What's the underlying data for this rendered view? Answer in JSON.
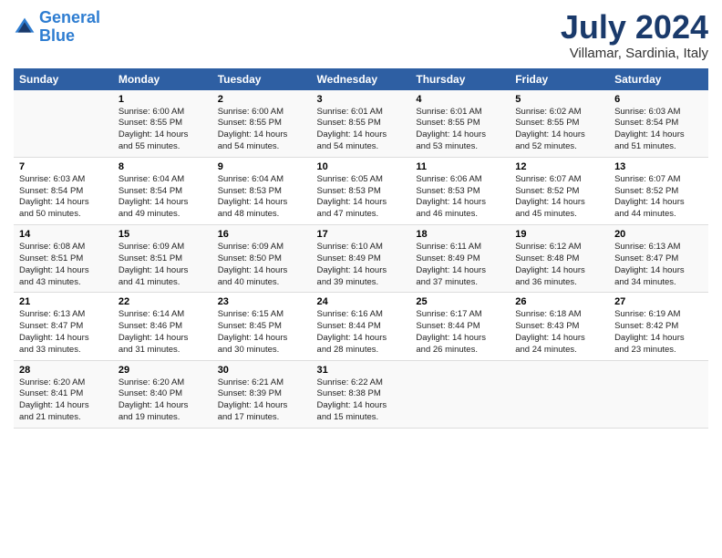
{
  "header": {
    "logo_line1": "General",
    "logo_line2": "Blue",
    "month": "July 2024",
    "location": "Villamar, Sardinia, Italy"
  },
  "days_of_week": [
    "Sunday",
    "Monday",
    "Tuesday",
    "Wednesday",
    "Thursday",
    "Friday",
    "Saturday"
  ],
  "weeks": [
    [
      {
        "num": "",
        "info": ""
      },
      {
        "num": "1",
        "info": "Sunrise: 6:00 AM\nSunset: 8:55 PM\nDaylight: 14 hours\nand 55 minutes."
      },
      {
        "num": "2",
        "info": "Sunrise: 6:00 AM\nSunset: 8:55 PM\nDaylight: 14 hours\nand 54 minutes."
      },
      {
        "num": "3",
        "info": "Sunrise: 6:01 AM\nSunset: 8:55 PM\nDaylight: 14 hours\nand 54 minutes."
      },
      {
        "num": "4",
        "info": "Sunrise: 6:01 AM\nSunset: 8:55 PM\nDaylight: 14 hours\nand 53 minutes."
      },
      {
        "num": "5",
        "info": "Sunrise: 6:02 AM\nSunset: 8:55 PM\nDaylight: 14 hours\nand 52 minutes."
      },
      {
        "num": "6",
        "info": "Sunrise: 6:03 AM\nSunset: 8:54 PM\nDaylight: 14 hours\nand 51 minutes."
      }
    ],
    [
      {
        "num": "7",
        "info": "Sunrise: 6:03 AM\nSunset: 8:54 PM\nDaylight: 14 hours\nand 50 minutes."
      },
      {
        "num": "8",
        "info": "Sunrise: 6:04 AM\nSunset: 8:54 PM\nDaylight: 14 hours\nand 49 minutes."
      },
      {
        "num": "9",
        "info": "Sunrise: 6:04 AM\nSunset: 8:53 PM\nDaylight: 14 hours\nand 48 minutes."
      },
      {
        "num": "10",
        "info": "Sunrise: 6:05 AM\nSunset: 8:53 PM\nDaylight: 14 hours\nand 47 minutes."
      },
      {
        "num": "11",
        "info": "Sunrise: 6:06 AM\nSunset: 8:53 PM\nDaylight: 14 hours\nand 46 minutes."
      },
      {
        "num": "12",
        "info": "Sunrise: 6:07 AM\nSunset: 8:52 PM\nDaylight: 14 hours\nand 45 minutes."
      },
      {
        "num": "13",
        "info": "Sunrise: 6:07 AM\nSunset: 8:52 PM\nDaylight: 14 hours\nand 44 minutes."
      }
    ],
    [
      {
        "num": "14",
        "info": "Sunrise: 6:08 AM\nSunset: 8:51 PM\nDaylight: 14 hours\nand 43 minutes."
      },
      {
        "num": "15",
        "info": "Sunrise: 6:09 AM\nSunset: 8:51 PM\nDaylight: 14 hours\nand 41 minutes."
      },
      {
        "num": "16",
        "info": "Sunrise: 6:09 AM\nSunset: 8:50 PM\nDaylight: 14 hours\nand 40 minutes."
      },
      {
        "num": "17",
        "info": "Sunrise: 6:10 AM\nSunset: 8:49 PM\nDaylight: 14 hours\nand 39 minutes."
      },
      {
        "num": "18",
        "info": "Sunrise: 6:11 AM\nSunset: 8:49 PM\nDaylight: 14 hours\nand 37 minutes."
      },
      {
        "num": "19",
        "info": "Sunrise: 6:12 AM\nSunset: 8:48 PM\nDaylight: 14 hours\nand 36 minutes."
      },
      {
        "num": "20",
        "info": "Sunrise: 6:13 AM\nSunset: 8:47 PM\nDaylight: 14 hours\nand 34 minutes."
      }
    ],
    [
      {
        "num": "21",
        "info": "Sunrise: 6:13 AM\nSunset: 8:47 PM\nDaylight: 14 hours\nand 33 minutes."
      },
      {
        "num": "22",
        "info": "Sunrise: 6:14 AM\nSunset: 8:46 PM\nDaylight: 14 hours\nand 31 minutes."
      },
      {
        "num": "23",
        "info": "Sunrise: 6:15 AM\nSunset: 8:45 PM\nDaylight: 14 hours\nand 30 minutes."
      },
      {
        "num": "24",
        "info": "Sunrise: 6:16 AM\nSunset: 8:44 PM\nDaylight: 14 hours\nand 28 minutes."
      },
      {
        "num": "25",
        "info": "Sunrise: 6:17 AM\nSunset: 8:44 PM\nDaylight: 14 hours\nand 26 minutes."
      },
      {
        "num": "26",
        "info": "Sunrise: 6:18 AM\nSunset: 8:43 PM\nDaylight: 14 hours\nand 24 minutes."
      },
      {
        "num": "27",
        "info": "Sunrise: 6:19 AM\nSunset: 8:42 PM\nDaylight: 14 hours\nand 23 minutes."
      }
    ],
    [
      {
        "num": "28",
        "info": "Sunrise: 6:20 AM\nSunset: 8:41 PM\nDaylight: 14 hours\nand 21 minutes."
      },
      {
        "num": "29",
        "info": "Sunrise: 6:20 AM\nSunset: 8:40 PM\nDaylight: 14 hours\nand 19 minutes."
      },
      {
        "num": "30",
        "info": "Sunrise: 6:21 AM\nSunset: 8:39 PM\nDaylight: 14 hours\nand 17 minutes."
      },
      {
        "num": "31",
        "info": "Sunrise: 6:22 AM\nSunset: 8:38 PM\nDaylight: 14 hours\nand 15 minutes."
      },
      {
        "num": "",
        "info": ""
      },
      {
        "num": "",
        "info": ""
      },
      {
        "num": "",
        "info": ""
      }
    ]
  ]
}
